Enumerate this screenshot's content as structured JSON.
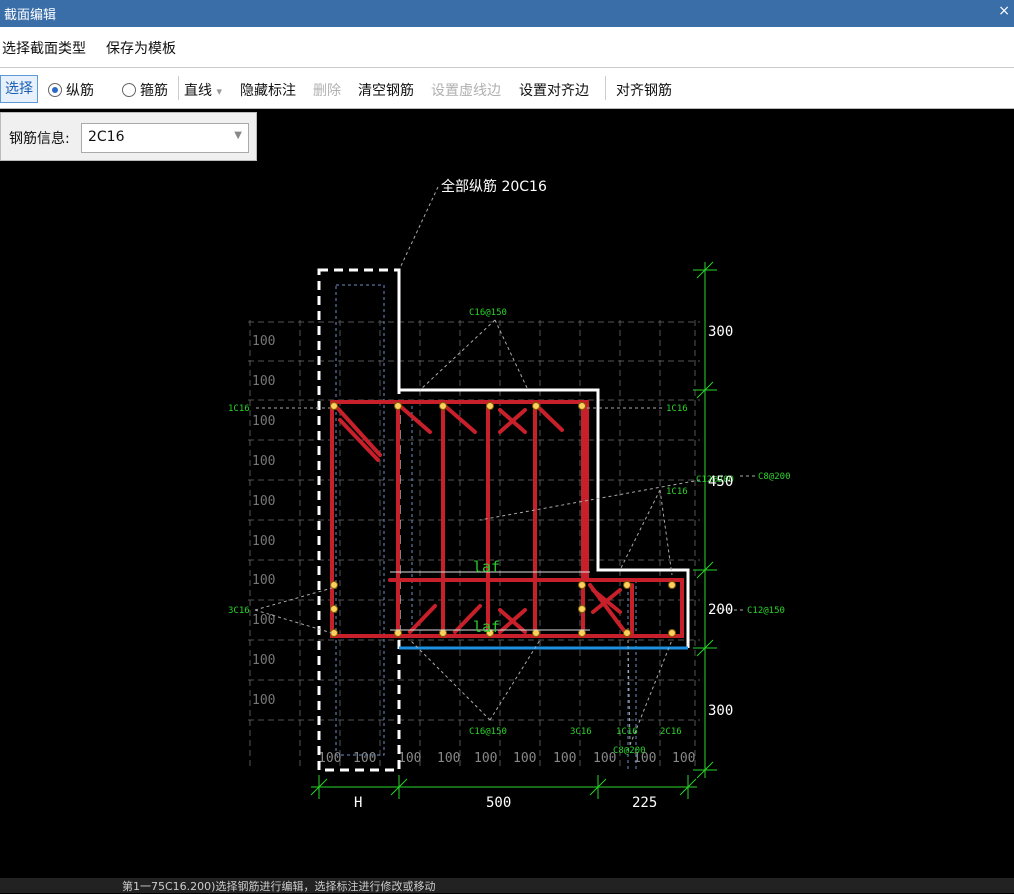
{
  "window": {
    "title": "截面编辑",
    "close": "×"
  },
  "menu": {
    "select_type": "选择截面类型",
    "save_template": "保存为模板"
  },
  "toolbar": {
    "select": "选择",
    "longitudinal": "纵筋",
    "stirrup": "箍筋",
    "line": "直线",
    "line_arrow": "▾",
    "hide_label": "隐藏标注",
    "delete": "删除",
    "clear_rebar": "清空钢筋",
    "set_dashed": "设置虚线边",
    "set_align_edge": "设置对齐边",
    "align_rebar": "对齐钢筋"
  },
  "rebar_info": {
    "label": "钢筋信息:",
    "value": "2C16"
  },
  "drawing": {
    "all_longitudinal": "全部纵筋 20C16",
    "labels": {
      "stirrup_top": "C16@150",
      "stirrup_bottom": "C16@150",
      "left_top": "1C16",
      "left_mid": "3C16",
      "right_top": "1C16",
      "right_mid_a": "C12@200",
      "right_mid_b": "1C16",
      "c8_200": "C8@200",
      "c12_150": "C12@150",
      "bot_3c16": "3C16",
      "bot_1c16": "1C16",
      "bot_2c16": "2C16",
      "bot_c8_200": "C8@200",
      "laf_top": "laf",
      "laf_bottom": "laf"
    },
    "grid_left": [
      "100",
      "100",
      "100",
      "100",
      "100",
      "100",
      "100",
      "100",
      "100",
      "100"
    ],
    "grid_bottom": [
      "100",
      "100",
      "100",
      "100",
      "100",
      "100",
      "100",
      "100",
      "100",
      "100"
    ],
    "dim_right": [
      "300",
      "450",
      "200",
      "300"
    ],
    "dim_bottom": [
      "H",
      "500",
      "225"
    ]
  },
  "status": "第1一75C16.200)选择钢筋进行编辑，选择标注进行修改或移动"
}
